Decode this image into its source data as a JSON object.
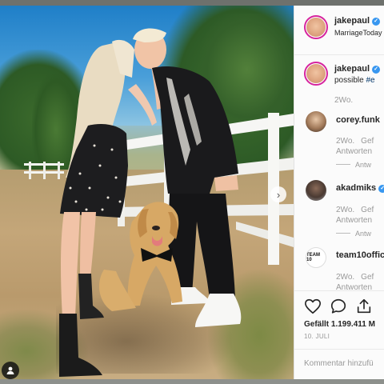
{
  "post": {
    "author": "jakepaul",
    "location": "MarriageToday",
    "caption_user": "jakepaul",
    "caption_text": "possible ",
    "caption_hashtag": "#e",
    "caption_time": "2Wo."
  },
  "comments": [
    {
      "user": "corey.funk",
      "time": "2Wo.",
      "likes": "Gef",
      "reply": "Antworten",
      "view_replies": "Antw"
    },
    {
      "user": "akadmiks",
      "time": "2Wo.",
      "likes": "Gef",
      "reply": "Antworten",
      "view_replies": "Antw"
    },
    {
      "user": "team10offic",
      "time": "2Wo.",
      "likes": "Gef",
      "reply": "Antworten"
    }
  ],
  "actions": {
    "likes_text": "Gefällt 1.199.411 M",
    "date": "10. JULI",
    "add_comment_placeholder": "Kommentar hinzufü"
  },
  "icons": {
    "verified": "verified-badge-icon",
    "like": "heart-icon",
    "comment": "comment-icon",
    "share": "share-icon",
    "next": "chevron-right-icon",
    "tag": "user-tag-icon"
  },
  "colors": {
    "verified": "#3897f0",
    "story_ring": "#d6249f",
    "hashtag": "#003569",
    "muted": "#999999"
  }
}
